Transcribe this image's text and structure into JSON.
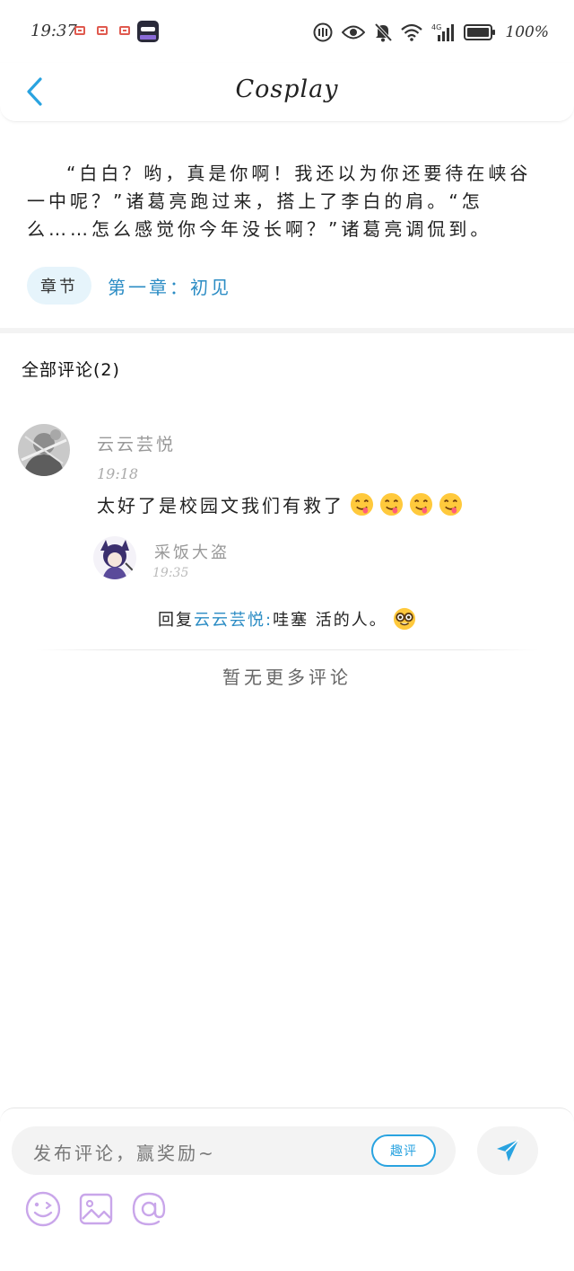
{
  "status_bar": {
    "time": "19:37",
    "battery": "100%",
    "network": "4G"
  },
  "header": {
    "title": "Cosplay"
  },
  "story": {
    "excerpt": "“白白？哟，真是你啊！我还以为你还要待在峡谷一中呢？”诸葛亮跑过来，搭上了李白的肩。“怎么……怎么感觉你今年没长啊？”诸葛亮调侃到。",
    "chapter_tag": "章节",
    "chapter_title": "第一章：初见"
  },
  "comments": {
    "heading": "全部评论(2)",
    "items": [
      {
        "name": "云云芸悦",
        "time": "19:18",
        "text": "太好了是校园文我们有救了",
        "emojis": [
          "😋",
          "😋",
          "😋",
          "😋"
        ],
        "reply": {
          "name": "采饭大盗",
          "time": "19:35",
          "prefix": "回复",
          "mention": "云云芸悦:",
          "text": "哇塞 活的人。",
          "emoji": "🤓"
        }
      }
    ],
    "no_more": "暂无更多评论"
  },
  "composer": {
    "placeholder": "发布评论，赢奖励~",
    "quping_label": "趣评"
  },
  "colors": {
    "accent": "#29a3e0",
    "link": "#2b8cc4",
    "tool_purple": "#c9a6ea"
  }
}
